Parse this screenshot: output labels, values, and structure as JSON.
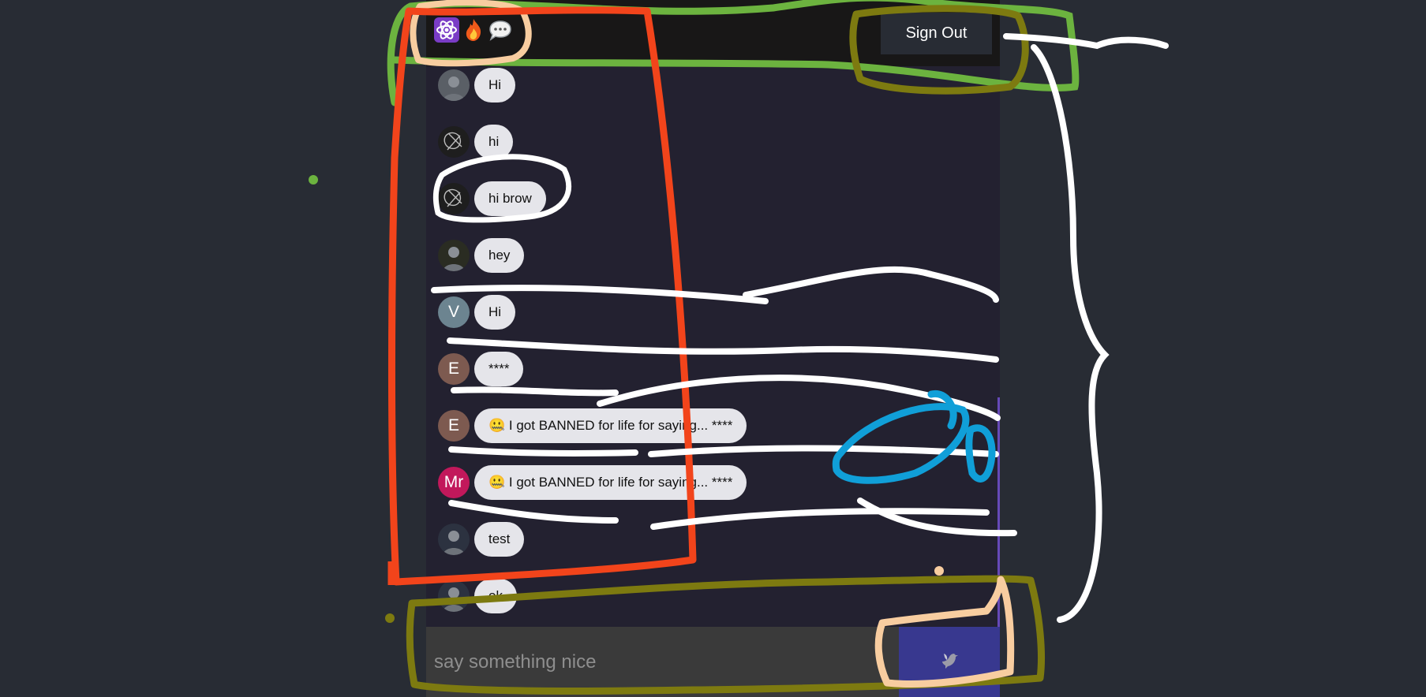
{
  "header": {
    "logo_icons": [
      "atom-icon",
      "fire-icon",
      "speech-bubble-icon"
    ],
    "sign_out_label": "Sign Out"
  },
  "messages": [
    {
      "avatar_type": "photo",
      "avatar_initials": "",
      "avatar_color": "#5a5f66",
      "text": "Hi"
    },
    {
      "avatar_type": "sketch",
      "avatar_initials": "",
      "avatar_color": "#1e1e1e",
      "text": "hi"
    },
    {
      "avatar_type": "sketch",
      "avatar_initials": "",
      "avatar_color": "#1e1e1e",
      "text": "hi brow"
    },
    {
      "avatar_type": "photo",
      "avatar_initials": "",
      "avatar_color": "#2a2c22",
      "text": "hey"
    },
    {
      "avatar_type": "initials",
      "avatar_initials": "V",
      "avatar_color": "#6c8490",
      "text": "Hi"
    },
    {
      "avatar_type": "initials",
      "avatar_initials": "E",
      "avatar_color": "#7d5a50",
      "text": "****"
    },
    {
      "avatar_type": "initials",
      "avatar_initials": "E",
      "avatar_color": "#7d5a50",
      "text": "🤐 I got BANNED for life for saying... ****"
    },
    {
      "avatar_type": "initials",
      "avatar_initials": "Mr",
      "avatar_color": "#c2185b",
      "text": "🤐 I got BANNED for life for saying... ****"
    },
    {
      "avatar_type": "photo",
      "avatar_initials": "",
      "avatar_color": "#2c3240",
      "text": "test"
    },
    {
      "avatar_type": "photo",
      "avatar_initials": "",
      "avatar_color": "#2c3240",
      "text": "ok"
    }
  ],
  "composer": {
    "placeholder": "say something nice",
    "send_icon": "dove-icon"
  },
  "colors": {
    "page_bg": "#282c34",
    "header_bg": "#181717",
    "messages_bg": "#232130",
    "bubble_bg": "#e5e5ea",
    "send_bg": "#38388f",
    "scrollbar": "#6649b8"
  }
}
